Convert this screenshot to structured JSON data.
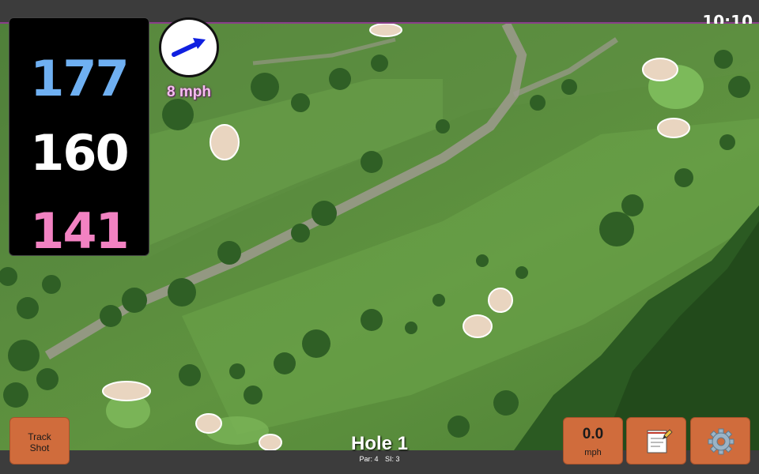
{
  "status_bar": {
    "time": "10:10"
  },
  "distances": {
    "back": "177",
    "center": "160",
    "front": "141"
  },
  "wind": {
    "speed": "8 mph",
    "icon": "wind-arrow-icon"
  },
  "hole": {
    "title": "Hole 1",
    "par": "Par: 4",
    "stroke_index": "SI: 3"
  },
  "buttons": {
    "track_shot_line1": "Track",
    "track_shot_line2": "Shot",
    "speed_value": "0.0",
    "speed_unit": "mph",
    "notes_icon": "notepad-icon",
    "settings_icon": "gear-icon"
  },
  "colors": {
    "back": "#6fb0f2",
    "center": "#ffffff",
    "front": "#f282c2",
    "button": "#d06c3c",
    "wind_label": "#f6bdf0"
  }
}
